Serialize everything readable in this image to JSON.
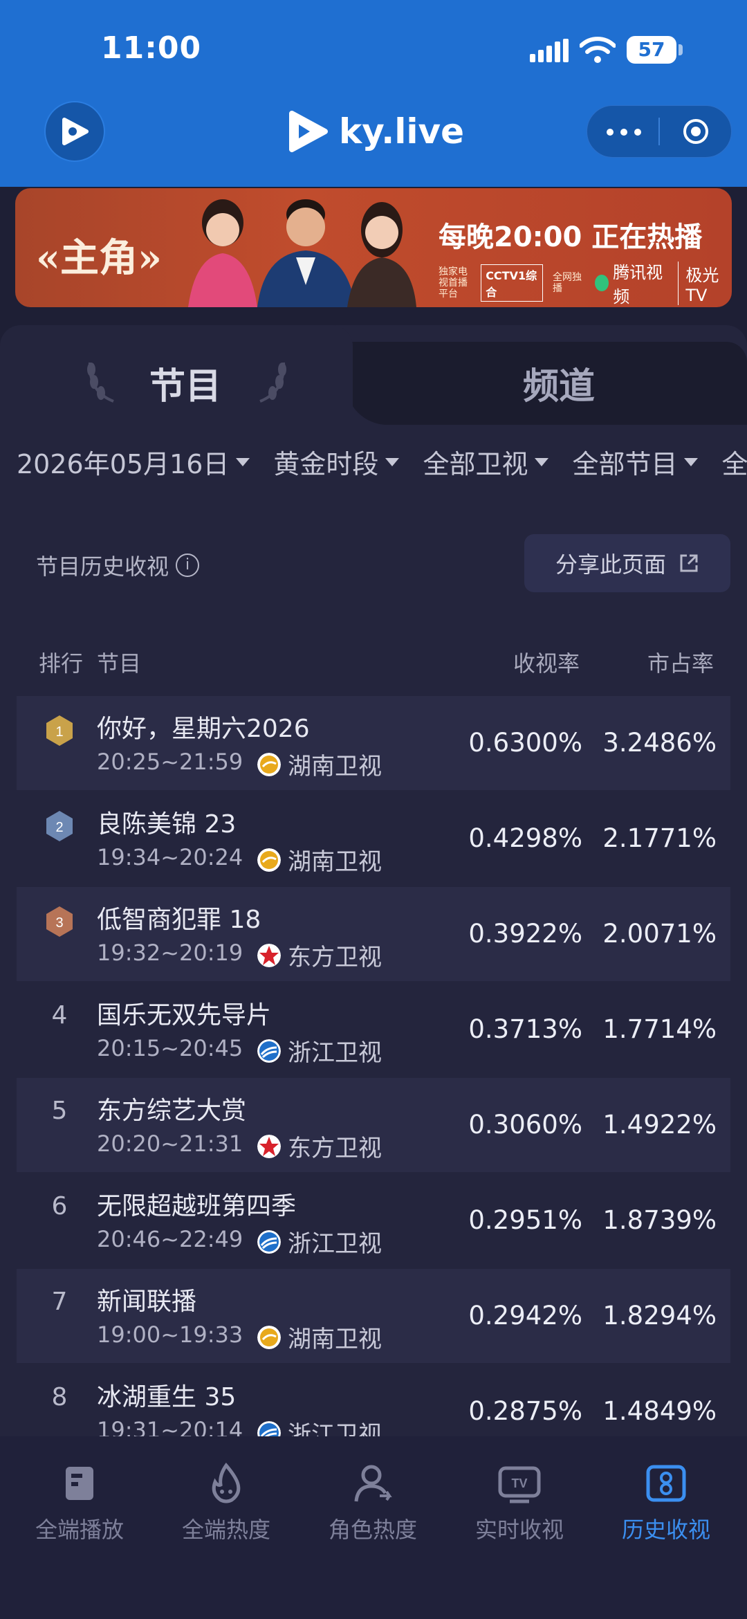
{
  "status_bar": {
    "time": "11:00",
    "battery": "57"
  },
  "header": {
    "logo_text": "ky.live"
  },
  "banner": {
    "title": "«主角»",
    "slogan": "每晚20:00 正在热播",
    "exclusive": "独家电视首播平台",
    "cctv": "CCTV1综合",
    "network_exclusive": "全网独播",
    "tencent": "腾讯视频",
    "jiguang": "极光TV"
  },
  "tabs": {
    "programs": "节目",
    "channels": "频道"
  },
  "filters": {
    "date": "2026年05月16日",
    "period": "黄金时段",
    "channel_scope": "全部卫视",
    "program_scope": "全部节目",
    "overflow": "全"
  },
  "section": {
    "title": "节目历史收视",
    "share_button": "分享此页面",
    "info_icon": "i"
  },
  "table": {
    "headers": {
      "rank": "排行",
      "program": "节目",
      "rating": "收视率",
      "share": "市占率"
    },
    "rows": [
      {
        "rank": "1",
        "name": "你好，星期六2026",
        "time": "20:25~21:59",
        "channel": "湖南卫视",
        "channel_color": "#e8a91c",
        "rating": "0.6300%",
        "share": "3.2486%"
      },
      {
        "rank": "2",
        "name": "良陈美锦 23",
        "time": "19:34~20:24",
        "channel": "湖南卫视",
        "channel_color": "#e8a91c",
        "rating": "0.4298%",
        "share": "2.1771%"
      },
      {
        "rank": "3",
        "name": "低智商犯罪 18",
        "time": "19:32~20:19",
        "channel": "东方卫视",
        "channel_color": "#d8222b",
        "rating": "0.3922%",
        "share": "2.0071%"
      },
      {
        "rank": "4",
        "name": "国乐无双先导片",
        "time": "20:15~20:45",
        "channel": "浙江卫视",
        "channel_color": "#1f6fc9",
        "rating": "0.3713%",
        "share": "1.7714%"
      },
      {
        "rank": "5",
        "name": "东方综艺大赏",
        "time": "20:20~21:31",
        "channel": "东方卫视",
        "channel_color": "#d8222b",
        "rating": "0.3060%",
        "share": "1.4922%"
      },
      {
        "rank": "6",
        "name": "无限超越班第四季",
        "time": "20:46~22:49",
        "channel": "浙江卫视",
        "channel_color": "#1f6fc9",
        "rating": "0.2951%",
        "share": "1.8739%"
      },
      {
        "rank": "7",
        "name": "新闻联播",
        "time": "19:00~19:33",
        "channel": "湖南卫视",
        "channel_color": "#e8a91c",
        "rating": "0.2942%",
        "share": "1.8294%"
      },
      {
        "rank": "8",
        "name": "冰湖重生 35",
        "time": "19:31~20:14",
        "channel": "浙江卫视",
        "channel_color": "#1f6fc9",
        "rating": "0.2875%",
        "share": "1.4849%"
      }
    ]
  },
  "bottom_nav": [
    {
      "label": "全端播放",
      "icon": "book-icon",
      "active": false
    },
    {
      "label": "全端热度",
      "icon": "flame-icon",
      "active": false
    },
    {
      "label": "角色热度",
      "icon": "user-icon",
      "active": false
    },
    {
      "label": "实时收视",
      "icon": "tv-icon",
      "active": false
    },
    {
      "label": "历史收视",
      "icon": "history-icon",
      "active": true
    }
  ],
  "colors": {
    "accent": "#3b8ff0",
    "header_blue": "#1f6fd1",
    "background": "#1e1f35",
    "gold_medal": "#c9a24a",
    "silver_medal": "#6d88b3",
    "bronze_medal": "#b77457"
  }
}
